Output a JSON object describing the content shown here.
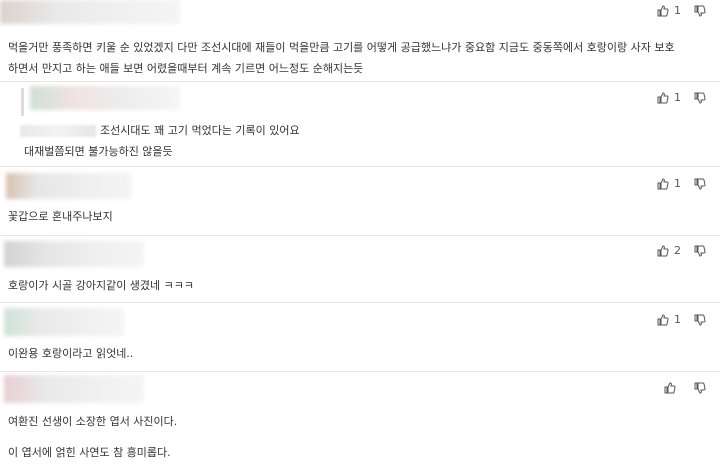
{
  "comments": [
    {
      "lines": [
        "먹을거만 풍족하면 키울 순 있었겠지 다만 조선시대에 재들이 먹을만큼 고기를 어떻게 공급했느냐가 중요함 지금도 중동쪽에서 호랑이랑 사자 보호",
        "하면서 만지고 하는 애들 보면 어렸을때부터 계속 기르면 어느정도 순해지는듯"
      ],
      "likes": "1"
    },
    {
      "lines": [
        "조선시대도 꽤 고기 먹었다는 기록이 있어요",
        "대재벌쯤되면 불가능하진 않을듯"
      ],
      "likes": "1"
    },
    {
      "lines": [
        "꽃갑으로 혼내주나보지"
      ],
      "likes": "1"
    },
    {
      "lines": [
        "호랑이가 시골 강아지같이 생겼네 ㅋㅋㅋ"
      ],
      "likes": "2"
    },
    {
      "lines": [
        "이완용 호랑이라고 읽엇네.."
      ],
      "likes": "1"
    },
    {
      "lines": [
        "여환진 선생이 소장한 엽서 사진이다.",
        "이 엽서에 얽힌 사연도 참 흥미롭다."
      ],
      "likes": ""
    }
  ],
  "icons": {
    "like": "thumbs-up-icon",
    "dislike": "thumbs-down-icon"
  }
}
